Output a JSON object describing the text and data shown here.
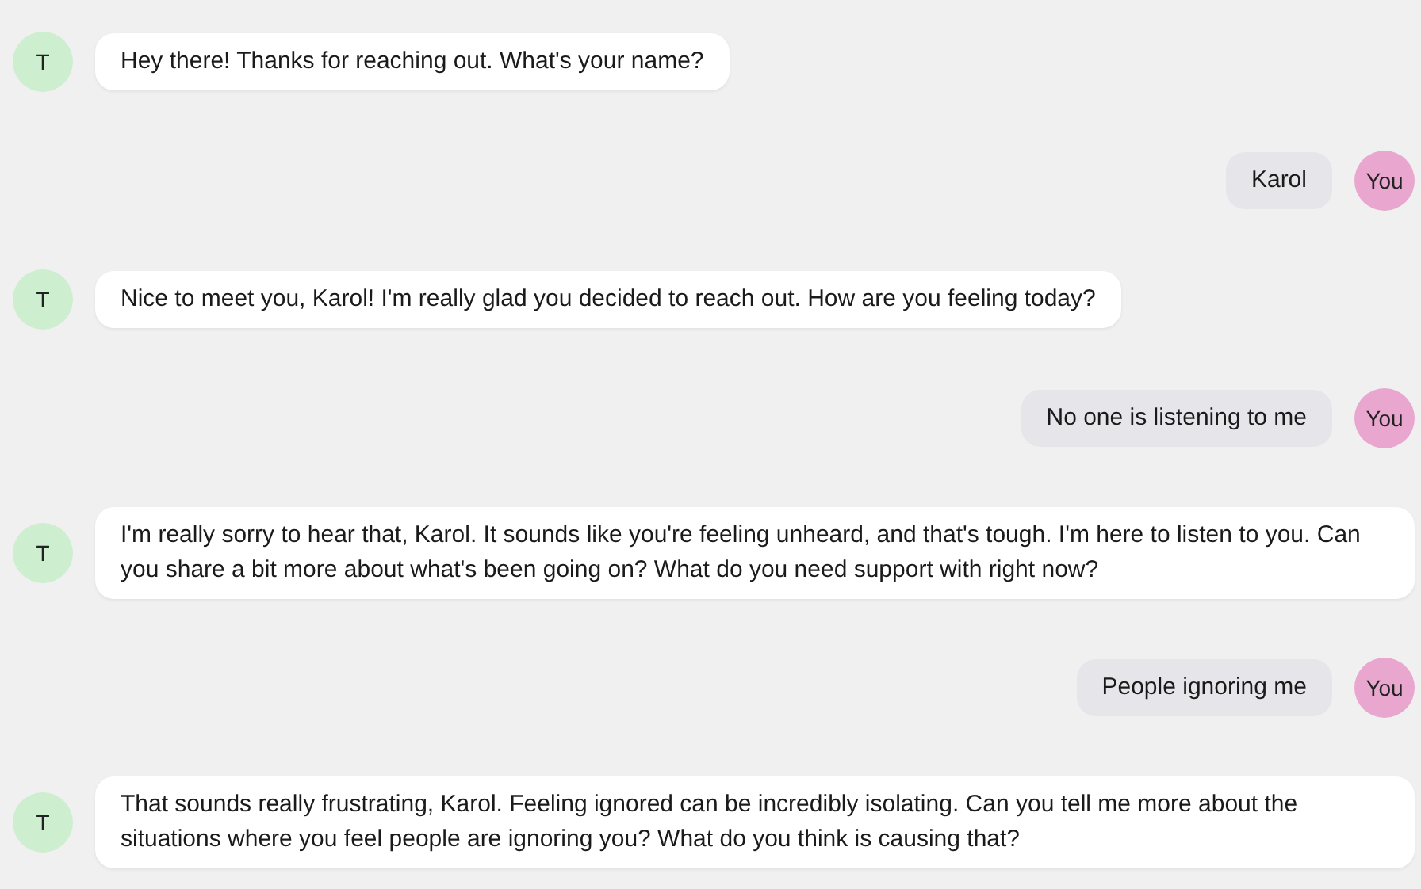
{
  "messages": [
    {
      "kind": "bot",
      "avatar": "T",
      "text": "Hey there! Thanks for reaching out. What's your name?"
    },
    {
      "kind": "user",
      "avatar": "You",
      "text": "Karol"
    },
    {
      "kind": "bot",
      "avatar": "T",
      "text": "Nice to meet you, Karol! I'm really glad you decided to reach out. How are you feeling today?"
    },
    {
      "kind": "user",
      "avatar": "You",
      "text": "No one is listening to me"
    },
    {
      "kind": "bot",
      "avatar": "T",
      "text": "I'm really sorry to hear that, Karol. It sounds like you're feeling unheard, and that's tough. I'm here to listen to you. Can you share a bit more about what's been going on? What do you need support with right now?"
    },
    {
      "kind": "user",
      "avatar": "You",
      "text": "People ignoring me"
    },
    {
      "kind": "bot",
      "avatar": "T",
      "text": "That sounds really frustrating, Karol. Feeling ignored can be incredibly isolating. Can you tell me more about the situations where you feel people are ignoring you? What do you think is causing that?"
    }
  ]
}
